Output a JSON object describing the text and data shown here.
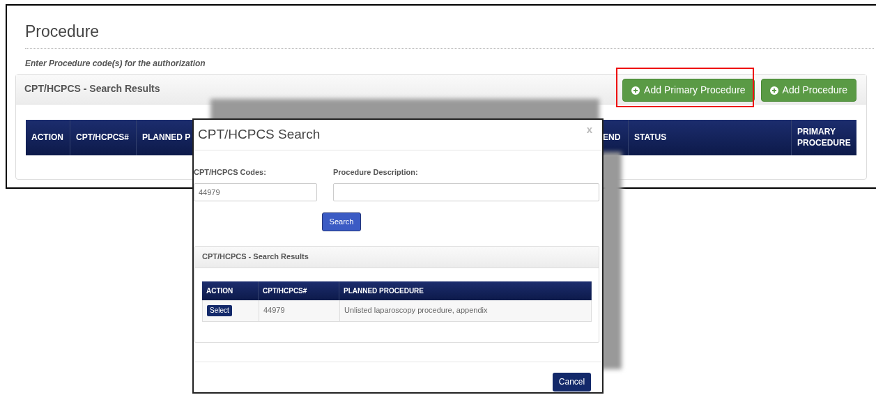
{
  "page": {
    "title": "Procedure",
    "instruction": "Enter Procedure code(s) for the authorization",
    "panel": {
      "title": "CPT/HCPCS - Search Results",
      "buttons": [
        {
          "label": "Add Primary Procedure",
          "highlighted": true
        },
        {
          "label": "Add Procedure",
          "highlighted": false
        }
      ],
      "columns": [
        "ACTION",
        "CPT/HCPCS#",
        "PLANNED P",
        "END",
        "STATUS",
        "PRIMARY PROCEDURE"
      ]
    }
  },
  "dialog": {
    "title": "CPT/HCPCS Search",
    "close": "x",
    "fields": [
      {
        "label": "CPT/HCPCS Codes:",
        "value": "44979"
      },
      {
        "label": "Procedure Description:"
      }
    ],
    "search_button": "Search",
    "results": {
      "title": "CPT/HCPCS - Search Results",
      "columns": [
        "ACTION",
        "CPT/HCPCS#",
        "PLANNED PROCEDURE"
      ],
      "rows": [
        {
          "action": "Select",
          "code": "44979",
          "procedure": "Unlisted laparoscopy procedure, appendix"
        }
      ]
    },
    "cancel_button": "Cancel"
  }
}
